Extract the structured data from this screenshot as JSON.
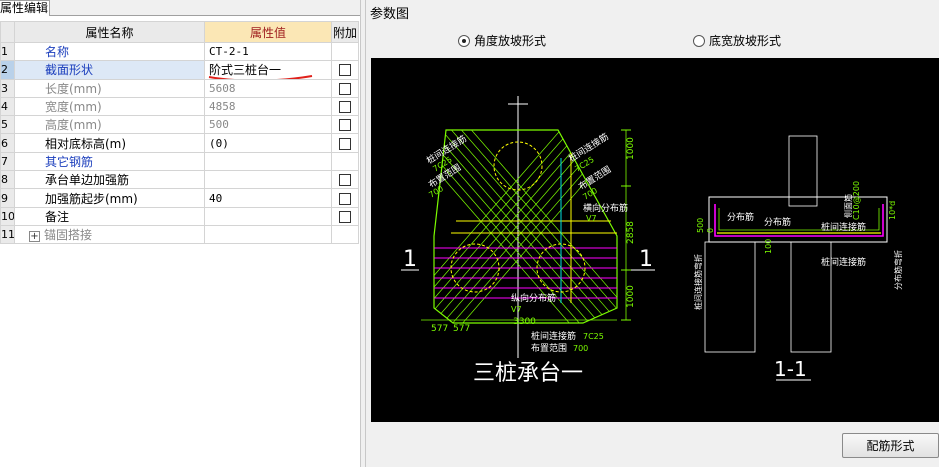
{
  "left_panel": {
    "tab_label": "属性编辑",
    "columns": {
      "name": "属性名称",
      "value": "属性值",
      "extra": "附加"
    },
    "rows": [
      {
        "num": "1",
        "name": "名称",
        "value": "CT-2-1",
        "checkbox": false
      },
      {
        "num": "2",
        "name": "截面形状",
        "value": "阶式三桩台一",
        "checkbox": true
      },
      {
        "num": "3",
        "name": "长度(mm)",
        "value": "5608",
        "checkbox": true
      },
      {
        "num": "4",
        "name": "宽度(mm)",
        "value": "4858",
        "checkbox": true
      },
      {
        "num": "5",
        "name": "高度(mm)",
        "value": "500",
        "checkbox": true
      },
      {
        "num": "6",
        "name": "相对底标高(m)",
        "value": "(0)",
        "checkbox": true
      },
      {
        "num": "7",
        "name": "其它钢筋",
        "value": "",
        "checkbox": false
      },
      {
        "num": "8",
        "name": "承台单边加强筋",
        "value": "",
        "checkbox": true
      },
      {
        "num": "9",
        "name": "加强筋起步(mm)",
        "value": "40",
        "checkbox": true
      },
      {
        "num": "10",
        "name": "备注",
        "value": "",
        "checkbox": true
      },
      {
        "num": "11",
        "name": "锚固搭接",
        "value": "",
        "checkbox": false,
        "expander": "+"
      }
    ]
  },
  "right_panel": {
    "title": "参数图",
    "radio_options": [
      {
        "label": "角度放坡形式",
        "selected": true
      },
      {
        "label": "底宽放坡形式",
        "selected": false
      }
    ],
    "config_button": "配筋形式",
    "drawing": {
      "plan_title": "三桩承台一",
      "section_title": "1-1",
      "section_marker": "1",
      "labels": {
        "pile_tie_bar": "桩间连接筋",
        "bar_spec": "7C25",
        "layout_range": "布置范围",
        "range_value": "700",
        "transverse_bar": "横向分布筋",
        "longitudinal_bar": "纵向分布筋",
        "v_mark": "V7",
        "dim_1000": "1000",
        "dim_2858": "2858",
        "dim_577": "577",
        "dim_3300": "3300",
        "dist_bar": "分布筋",
        "dim_500": "500",
        "dim_100": "100",
        "dim_0": "0",
        "side_label_left": "桩间连接筋弯折",
        "side_label_right": "分布筋弯折",
        "side_label_10d": "10*d",
        "top_stirrup": "C10@200",
        "stirrup_label": "侧面筋"
      }
    }
  },
  "colors": {
    "green": "#7cfc00",
    "yellow": "#ffff00",
    "magenta": "#ff00ff",
    "cyan": "#00e0e0",
    "white": "#ffffff"
  }
}
